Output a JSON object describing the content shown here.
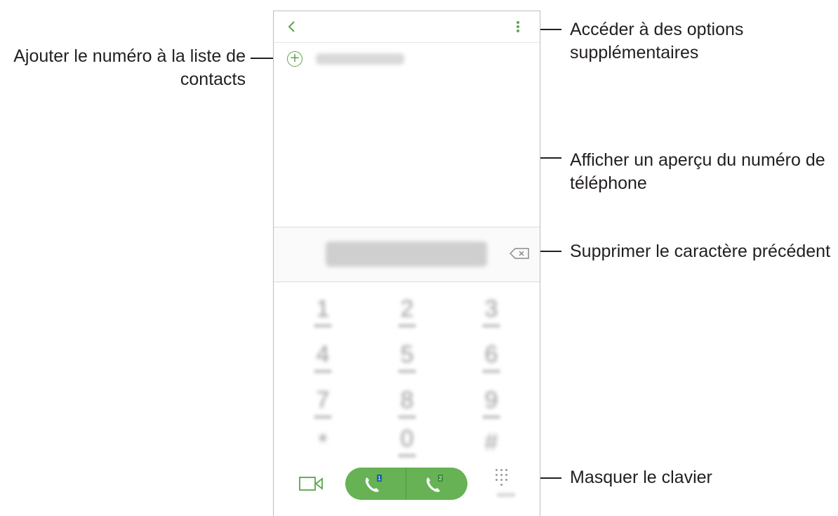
{
  "callouts": {
    "add_contact": "Ajouter le numéro à la liste de contacts",
    "add_contact_line1": "Ajouter le numéro à la liste de",
    "add_contact_line2": "contacts",
    "more_options_line1": "Accéder à des options",
    "more_options_line2": "supplémentaires",
    "preview_line1": "Afficher un aperçu du numéro de",
    "preview_line2": "téléphone",
    "delete": "Supprimer le caractère précédent",
    "hide_keypad": "Masquer le clavier"
  },
  "keypad": {
    "keys": [
      "1",
      "2",
      "3",
      "4",
      "5",
      "6",
      "7",
      "8",
      "9",
      "*",
      "0",
      "#"
    ]
  },
  "call_buttons": {
    "sim1_label": "1",
    "sim2_label": "2"
  },
  "colors": {
    "accent_green": "#5aa64b",
    "call_green": "#66b255"
  },
  "icons": {
    "back": "back-icon",
    "more": "more-options-icon",
    "add": "add-contact-icon",
    "backspace": "backspace-icon",
    "video": "video-call-icon",
    "call": "phone-icon",
    "dialpad": "dialpad-icon"
  }
}
